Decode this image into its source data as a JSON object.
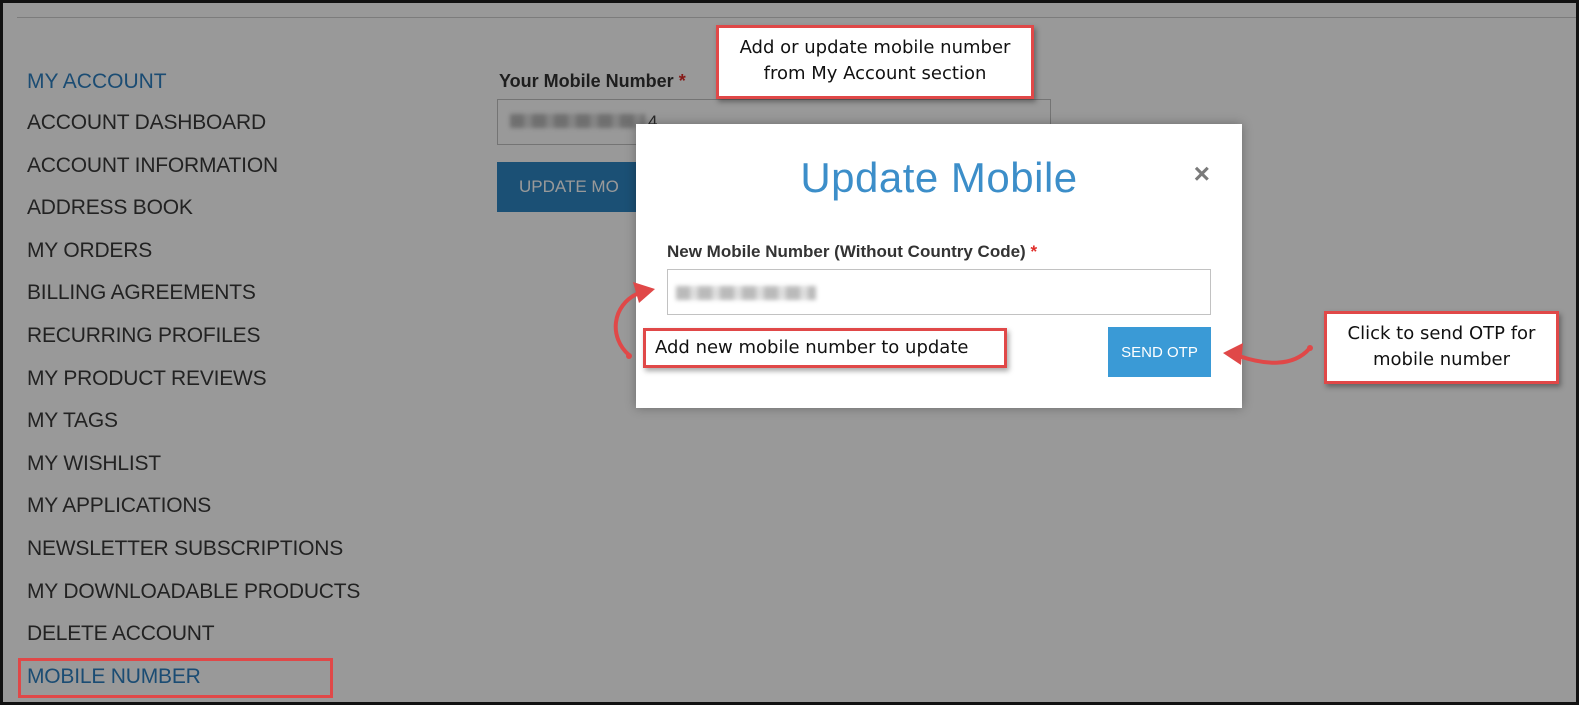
{
  "sidebar": {
    "title": "MY ACCOUNT",
    "items": [
      {
        "label": "ACCOUNT DASHBOARD"
      },
      {
        "label": "ACCOUNT INFORMATION"
      },
      {
        "label": "ADDRESS BOOK"
      },
      {
        "label": "MY ORDERS"
      },
      {
        "label": "BILLING AGREEMENTS"
      },
      {
        "label": "RECURRING PROFILES"
      },
      {
        "label": "MY PRODUCT REVIEWS"
      },
      {
        "label": "MY TAGS"
      },
      {
        "label": "MY WISHLIST"
      },
      {
        "label": "MY APPLICATIONS"
      },
      {
        "label": "NEWSLETTER SUBSCRIPTIONS"
      },
      {
        "label": "MY DOWNLOADABLE PRODUCTS"
      },
      {
        "label": "DELETE ACCOUNT"
      },
      {
        "label": "MOBILE NUMBER"
      }
    ]
  },
  "main": {
    "mobile_label": "Your Mobile Number",
    "required_mark": "*",
    "mobile_value_visible": "4",
    "update_button": "UPDATE MO"
  },
  "modal": {
    "title": "Update Mobile",
    "close": "×",
    "field_label": "New Mobile Number (Without Country Code)",
    "required_mark": "*",
    "send_otp": "SEND OTP"
  },
  "callouts": {
    "account_section": "Add or update mobile number from My Account section",
    "new_number": "Add new mobile number to update",
    "send_otp": "Click to send OTP for mobile number"
  },
  "colors": {
    "accent": "#2d7fc0",
    "button": "#2d86c4",
    "callout_border": "#e04848",
    "required": "#e02b27"
  }
}
